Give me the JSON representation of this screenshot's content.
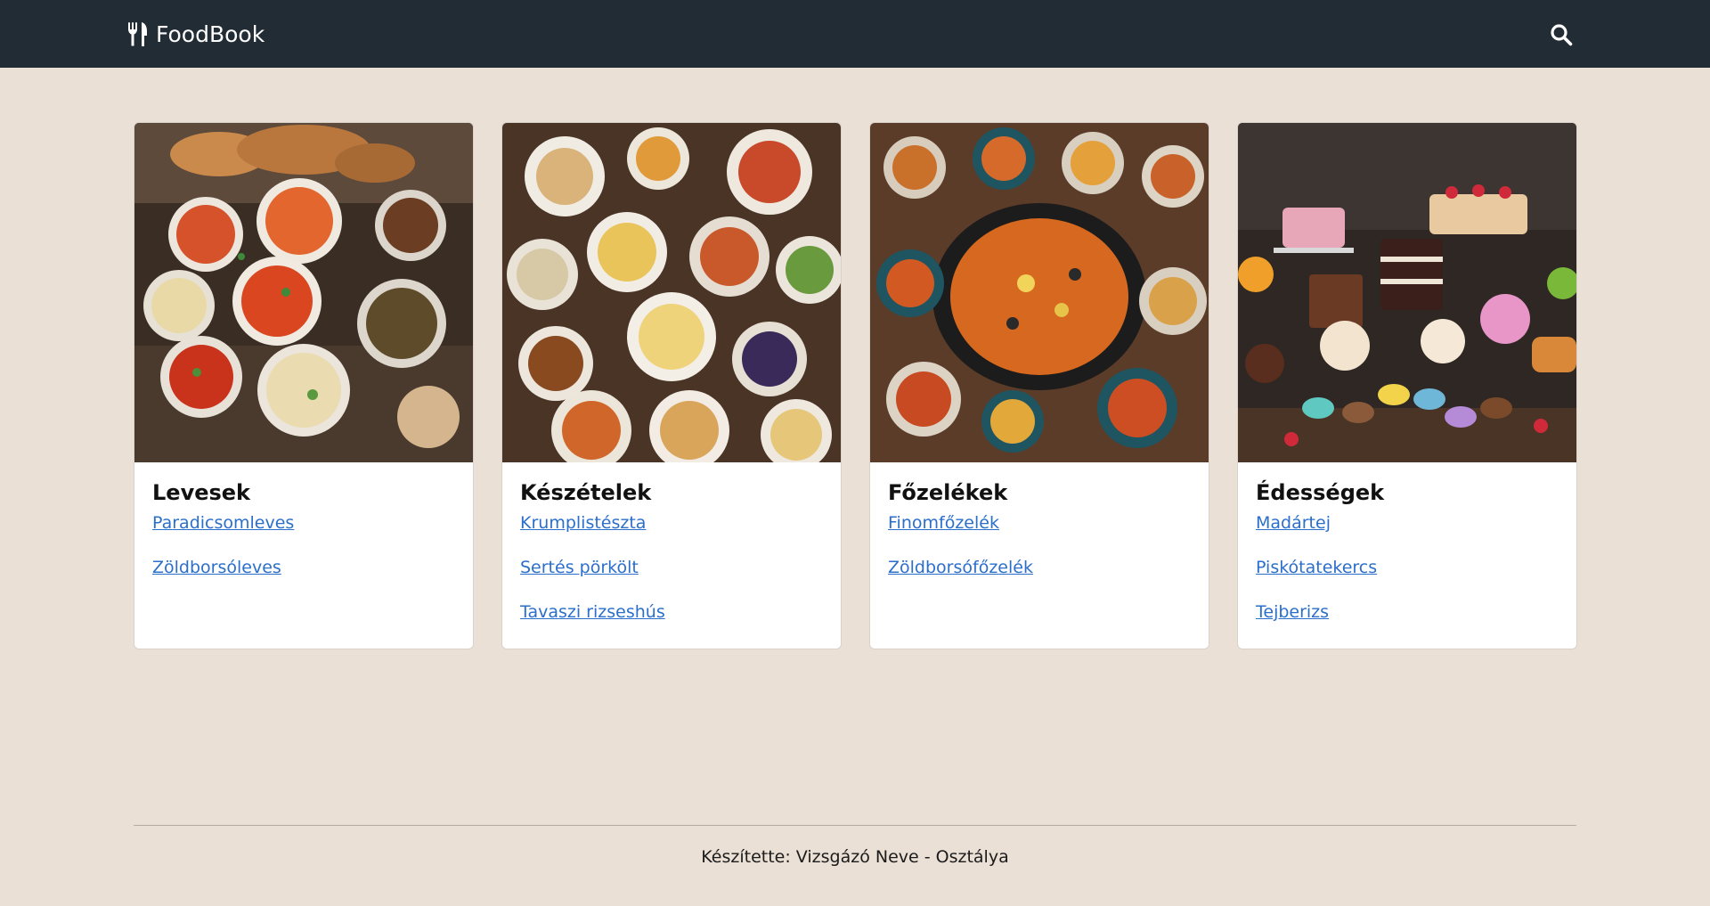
{
  "header": {
    "brand_icon": "fork-knife-icon",
    "brand": "FoodBook",
    "search_icon": "search-icon"
  },
  "categories": [
    {
      "title": "Levesek",
      "image": "soups-photo",
      "links": [
        "Paradicsomleves",
        "Zöldborsóleves"
      ]
    },
    {
      "title": "Készételek",
      "image": "ready-meals-photo",
      "links": [
        "Krumplistészta",
        "Sertés pörkölt",
        "Tavaszi rizseshús"
      ]
    },
    {
      "title": "Főzelékek",
      "image": "stews-photo",
      "links": [
        "Finomfőzelék",
        "Zöldborsófőzelék"
      ]
    },
    {
      "title": "Édességek",
      "image": "desserts-photo",
      "links": [
        "Madártej",
        "Piskótatekercs",
        "Tejberizs"
      ]
    }
  ],
  "footer": {
    "text": "Készítette: Vizsgázó Neve - Osztálya"
  },
  "colors": {
    "navbar": "#212c35",
    "background": "#ebe0d6",
    "link": "#2b6fcb"
  }
}
